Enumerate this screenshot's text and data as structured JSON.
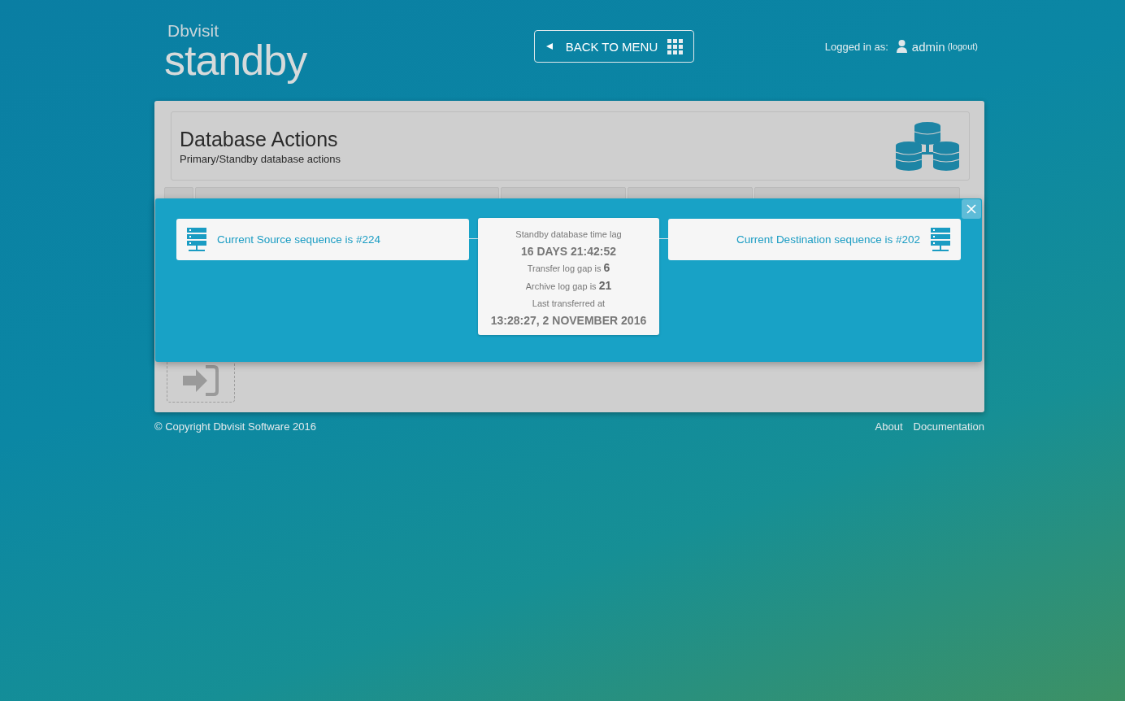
{
  "header": {
    "logo": {
      "brand": "Dbvisit",
      "product": "standby"
    },
    "back_button": {
      "label": "BACK TO MENU"
    },
    "user": {
      "prefix": "Logged in as:",
      "name": "admin",
      "logout": "(logout)"
    }
  },
  "panel": {
    "title": "Database Actions",
    "subtitle": "Primary/Standby database actions"
  },
  "modal": {
    "source": "Current Source sequence is #224",
    "destination": "Current Destination sequence is #202",
    "lag_card": [
      {
        "kind": "label",
        "text": "Standby database time lag"
      },
      {
        "kind": "value",
        "text": "16 DAYS 21:42:52"
      },
      {
        "kind": "label",
        "text": "Transfer log gap is **6**"
      },
      {
        "kind": "label",
        "text": "Archive log gap is **21**"
      },
      {
        "kind": "label",
        "text": "Last transferred at"
      },
      {
        "kind": "value",
        "text": "13:28:27, 2 NOVEMBER 2016"
      }
    ]
  },
  "footer": {
    "copyright": "© Copyright Dbvisit Software 2016",
    "links": [
      "About",
      "Documentation"
    ]
  }
}
